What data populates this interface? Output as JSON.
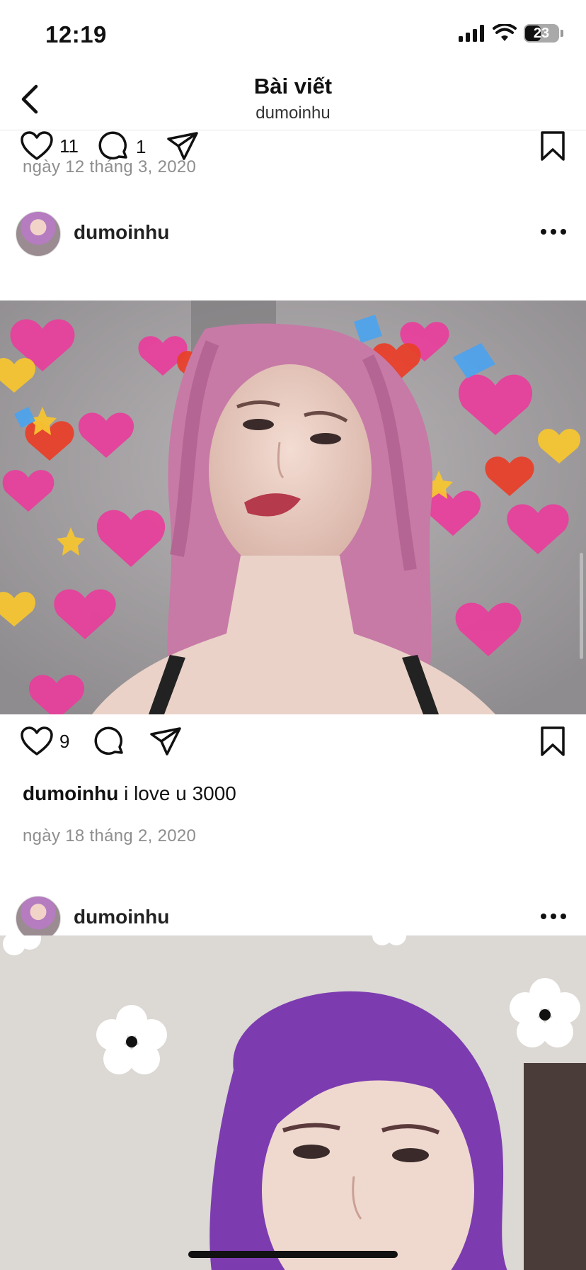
{
  "status_bar": {
    "time": "12:19",
    "battery": "23"
  },
  "header": {
    "title": "Bài viết",
    "subtitle": "dumoinhu"
  },
  "posts": [
    {
      "likes": "11",
      "comments": "1",
      "date": "ngày 12 tháng 3, 2020"
    },
    {
      "username": "dumoinhu",
      "likes": "9",
      "caption_user": "dumoinhu",
      "caption_text": "i love u 3000",
      "date": "ngày 18 tháng 2, 2020"
    },
    {
      "username": "dumoinhu"
    }
  ],
  "colors": {
    "text": "#111111",
    "secondary": "#8e8e8e",
    "heart_pink": "#e83e9b"
  }
}
